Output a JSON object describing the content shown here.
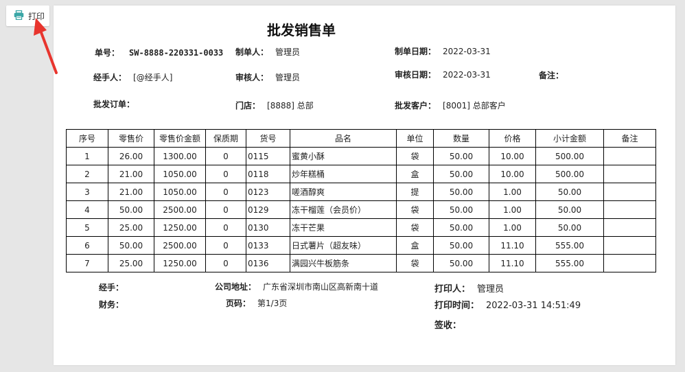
{
  "toolbar": {
    "print_label": "打印"
  },
  "doc": {
    "title": "批发销售单",
    "fields": {
      "bill_no_label": "单号：",
      "bill_no": "SW-8888-220331-0033",
      "maker_label": "制单人：",
      "maker": "管理员",
      "make_date_label": "制单日期：",
      "make_date": "2022-03-31",
      "handler_label": "经手人：",
      "handler": "[@经手人]",
      "auditor_label": "审核人：",
      "auditor": "管理员",
      "audit_date_label": "审核日期：",
      "audit_date": "2022-03-31",
      "remark_label": "备注：",
      "order_label": "批发订单：",
      "store_label": "门店：",
      "store": "[8888] 总部",
      "customer_label": "批发客户：",
      "customer": "[8001] 总部客户"
    },
    "table": {
      "headers": [
        "序号",
        "零售价",
        "零售价金额",
        "保质期",
        "货号",
        "品名",
        "单位",
        "数量",
        "价格",
        "小计金额",
        "备注"
      ],
      "rows": [
        [
          "1",
          "26.00",
          "1300.00",
          "0",
          "0115",
          "蜜黄小酥",
          "袋",
          "50.00",
          "10.00",
          "500.00",
          ""
        ],
        [
          "2",
          "21.00",
          "1050.00",
          "0",
          "0118",
          "炒年糕桶",
          "盒",
          "50.00",
          "10.00",
          "500.00",
          ""
        ],
        [
          "3",
          "21.00",
          "1050.00",
          "0",
          "0123",
          "嗟酒醇爽",
          "提",
          "50.00",
          "1.00",
          "50.00",
          ""
        ],
        [
          "4",
          "50.00",
          "2500.00",
          "0",
          "0129",
          "冻干榴莲（会员价）",
          "袋",
          "50.00",
          "1.00",
          "50.00",
          ""
        ],
        [
          "5",
          "25.00",
          "1250.00",
          "0",
          "0130",
          "冻干芒果",
          "袋",
          "50.00",
          "1.00",
          "50.00",
          ""
        ],
        [
          "6",
          "50.00",
          "2500.00",
          "0",
          "0133",
          "日式薯片（超友味）",
          "盒",
          "50.00",
          "11.10",
          "555.00",
          ""
        ],
        [
          "7",
          "25.00",
          "1250.00",
          "0",
          "0136",
          "满园兴牛板筋条",
          "袋",
          "50.00",
          "11.10",
          "555.00",
          ""
        ]
      ]
    },
    "footer": {
      "handler_label": "经手：",
      "finance_label": "财务：",
      "address_label": "公司地址：",
      "address": "广东省深圳市南山区高新南十道",
      "page_label": "页码：",
      "page": "第1/3页",
      "printer_label": "打印人：",
      "printer": "管理员",
      "print_time_label": "打印时间：",
      "print_time": "2022-03-31 14:51:49",
      "sign_label": "签收："
    }
  },
  "colors": {
    "print_icon": "#3aa6a6",
    "arrow": "#e8352e"
  }
}
